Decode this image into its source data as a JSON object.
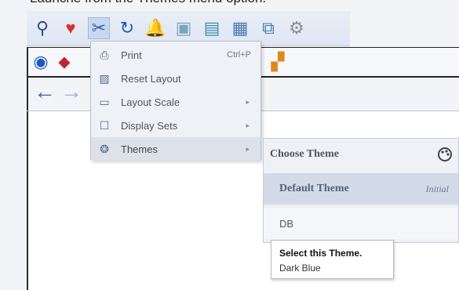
{
  "caption": {
    "text": "Launche from the Themes menu option."
  },
  "toolbar": {
    "icons": [
      {
        "name": "search-icon",
        "glyph": "⚲",
        "color": "#2b4a8a"
      },
      {
        "name": "heartbeat-icon",
        "glyph": "♥",
        "color": "#d83030"
      },
      {
        "name": "tools-icon",
        "glyph": "✂",
        "color": "#2a5ea8"
      },
      {
        "name": "refresh-icon",
        "glyph": "↻",
        "color": "#1f57b5"
      },
      {
        "name": "bell-icon",
        "glyph": "🔔",
        "color": "#9aa3b3"
      },
      {
        "name": "window-icon",
        "glyph": "▣",
        "color": "#7aa6b8"
      },
      {
        "name": "export-icon",
        "glyph": "▤",
        "color": "#3b8fb0"
      },
      {
        "name": "chart-icon",
        "glyph": "▦",
        "color": "#4a78b0"
      },
      {
        "name": "network-icon",
        "glyph": "⧉",
        "color": "#3b7fb6"
      },
      {
        "name": "settings-icon",
        "glyph": "⚙",
        "color": "#8a8f99"
      }
    ]
  },
  "toolbar2": {
    "icons": [
      {
        "name": "eye-icon",
        "glyph": "◉",
        "color": "#1e5bb8"
      },
      {
        "name": "redirect-icon",
        "glyph": "⬥",
        "color": "#c0272d"
      },
      {
        "name": "apps-icon",
        "glyph": "▞",
        "color": "#e0881a"
      }
    ]
  },
  "nav": {
    "back": {
      "glyph": "←",
      "color": "#2f66b5"
    },
    "forward": {
      "glyph": "→",
      "color": "#9fb3d3"
    }
  },
  "menu": {
    "items": [
      {
        "label": "Print",
        "shortcut": "Ctrl+P",
        "arrow": "",
        "icon": "printer-icon",
        "glyph": "⎙"
      },
      {
        "label": "Reset Layout",
        "shortcut": "",
        "arrow": "",
        "icon": "reset-layout-icon",
        "glyph": "▨"
      },
      {
        "label": "Layout Scale",
        "shortcut": "",
        "arrow": "▸",
        "icon": "layout-scale-icon",
        "glyph": "▭"
      },
      {
        "label": "Display Sets",
        "shortcut": "",
        "arrow": "▸",
        "icon": "display-sets-icon",
        "glyph": "☐"
      },
      {
        "label": "Themes",
        "shortcut": "",
        "arrow": "▸",
        "icon": "palette-icon",
        "glyph": "❂"
      }
    ]
  },
  "submenu": {
    "header": "Choose Theme",
    "items": [
      {
        "label": "Default Theme",
        "tag": "Initial"
      },
      {
        "label": "DB",
        "tag": ""
      }
    ]
  },
  "tooltip": {
    "title": "Select this Theme.",
    "desc": "Dark Blue"
  }
}
